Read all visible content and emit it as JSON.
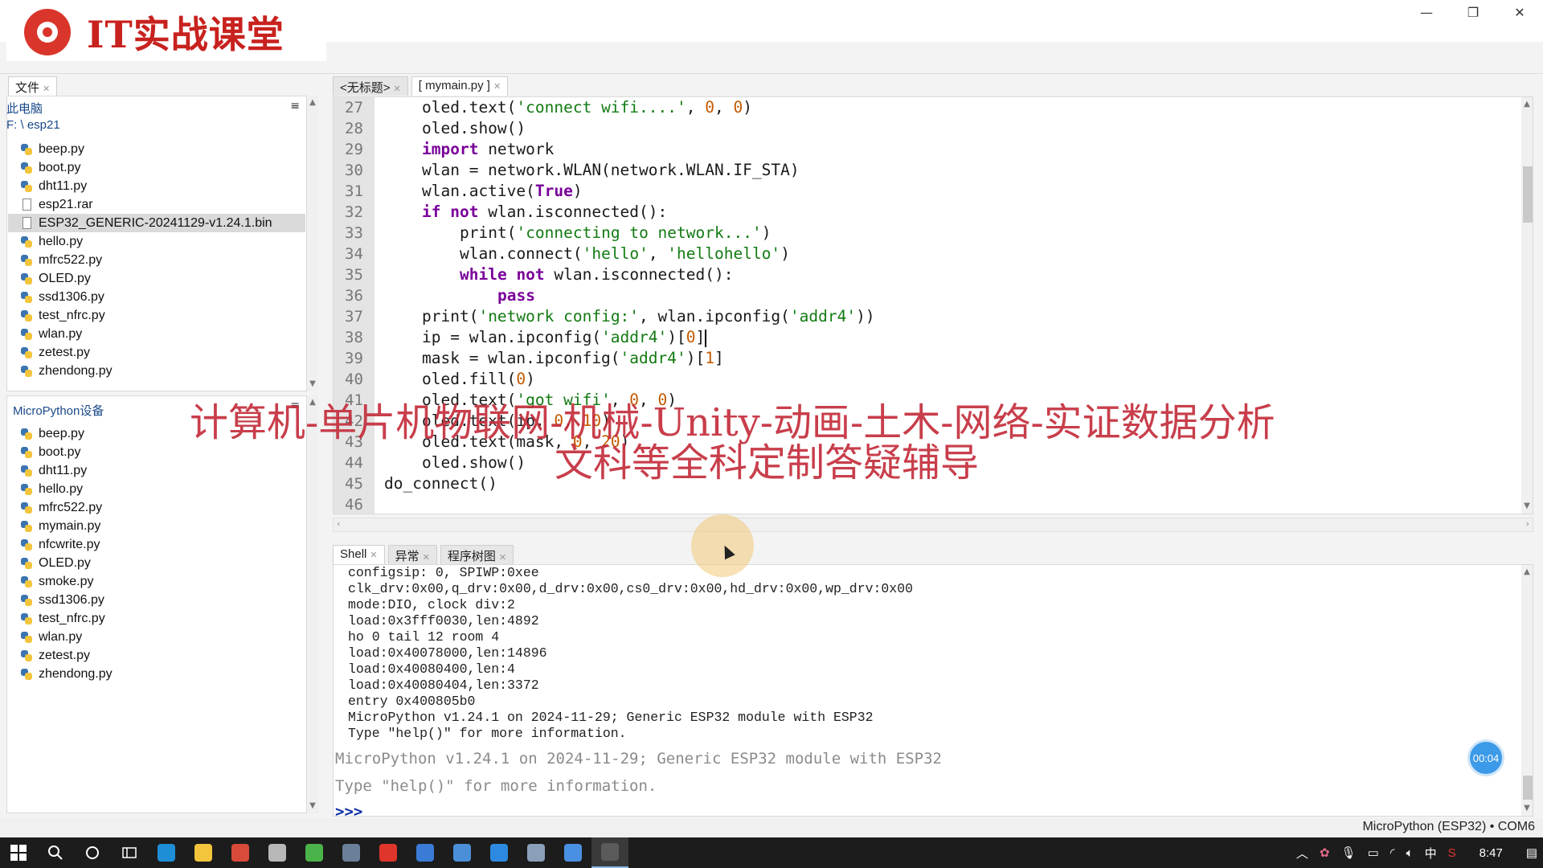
{
  "logo": {
    "text": "IT实战课堂"
  },
  "window_controls": {
    "minimize": "—",
    "restore": "❐",
    "close": "✕"
  },
  "files_panel": {
    "tab_label": "文件",
    "computer_label": "此电脑",
    "path": "F: \\ esp21",
    "files": [
      {
        "name": "beep.py",
        "type": "py"
      },
      {
        "name": "boot.py",
        "type": "py"
      },
      {
        "name": "dht11.py",
        "type": "py"
      },
      {
        "name": "esp21.rar",
        "type": "file"
      },
      {
        "name": "ESP32_GENERIC-20241129-v1.24.1.bin",
        "type": "file",
        "selected": true
      },
      {
        "name": "hello.py",
        "type": "py"
      },
      {
        "name": "mfrc522.py",
        "type": "py"
      },
      {
        "name": "OLED.py",
        "type": "py"
      },
      {
        "name": "ssd1306.py",
        "type": "py"
      },
      {
        "name": "test_nfrc.py",
        "type": "py"
      },
      {
        "name": "wlan.py",
        "type": "py"
      },
      {
        "name": "zetest.py",
        "type": "py"
      },
      {
        "name": "zhendong.py",
        "type": "py"
      }
    ]
  },
  "device_panel": {
    "header": "MicroPython设备",
    "files": [
      {
        "name": "beep.py"
      },
      {
        "name": "boot.py"
      },
      {
        "name": "dht11.py"
      },
      {
        "name": "hello.py"
      },
      {
        "name": "mfrc522.py"
      },
      {
        "name": "mymain.py"
      },
      {
        "name": "nfcwrite.py"
      },
      {
        "name": "OLED.py"
      },
      {
        "name": "smoke.py"
      },
      {
        "name": "ssd1306.py"
      },
      {
        "name": "test_nfrc.py"
      },
      {
        "name": "wlan.py"
      },
      {
        "name": "zetest.py"
      },
      {
        "name": "zhendong.py"
      }
    ]
  },
  "editor": {
    "tabs": [
      {
        "label": "<无标题>"
      },
      {
        "label": "[ mymain.py ]"
      }
    ],
    "lines": [
      {
        "num": "27",
        "indent": 1,
        "tokens": [
          [
            "t",
            "oled.text("
          ],
          [
            "s",
            "'connect wifi....'"
          ],
          [
            "t",
            ", "
          ],
          [
            "n",
            "0"
          ],
          [
            "t",
            ", "
          ],
          [
            "n",
            "0"
          ],
          [
            "t",
            ")"
          ]
        ]
      },
      {
        "num": "28",
        "indent": 1,
        "tokens": [
          [
            "t",
            "oled.show()"
          ]
        ]
      },
      {
        "num": "29",
        "indent": 1,
        "tokens": [
          [
            "k",
            "import"
          ],
          [
            "t",
            " network"
          ]
        ]
      },
      {
        "num": "30",
        "indent": 1,
        "tokens": [
          [
            "t",
            "wlan = network.WLAN(network.WLAN.IF_STA)"
          ]
        ]
      },
      {
        "num": "31",
        "indent": 1,
        "tokens": [
          [
            "t",
            "wlan.active("
          ],
          [
            "k",
            "True"
          ],
          [
            "t",
            ")"
          ]
        ]
      },
      {
        "num": "32",
        "indent": 1,
        "tokens": [
          [
            "k",
            "if not"
          ],
          [
            "t",
            " wlan.isconnected():"
          ]
        ]
      },
      {
        "num": "33",
        "indent": 2,
        "tokens": [
          [
            "t",
            "print("
          ],
          [
            "s",
            "'connecting to network...'"
          ],
          [
            "t",
            ")"
          ]
        ]
      },
      {
        "num": "34",
        "indent": 2,
        "tokens": [
          [
            "t",
            "wlan.connect("
          ],
          [
            "s",
            "'hello'"
          ],
          [
            "t",
            ", "
          ],
          [
            "s",
            "'hellohello'"
          ],
          [
            "t",
            ")"
          ]
        ]
      },
      {
        "num": "35",
        "indent": 2,
        "tokens": [
          [
            "k",
            "while not"
          ],
          [
            "t",
            " wlan.isconnected():"
          ]
        ]
      },
      {
        "num": "36",
        "indent": 3,
        "tokens": [
          [
            "k",
            "pass"
          ]
        ]
      },
      {
        "num": "37",
        "indent": 1,
        "tokens": [
          [
            "t",
            "print("
          ],
          [
            "s",
            "'network config:'"
          ],
          [
            "t",
            ", wlan.ipconfig("
          ],
          [
            "s",
            "'addr4'"
          ],
          [
            "t",
            "))"
          ]
        ]
      },
      {
        "num": "38",
        "indent": 1,
        "tokens": [
          [
            "t",
            "ip = wlan.ipconfig("
          ],
          [
            "s",
            "'addr4'"
          ],
          [
            "t",
            ")["
          ],
          [
            "n",
            "0"
          ],
          [
            "t",
            "]"
          ],
          [
            "c",
            "caret"
          ]
        ]
      },
      {
        "num": "39",
        "indent": 1,
        "tokens": [
          [
            "t",
            "mask = wlan.ipconfig("
          ],
          [
            "s",
            "'addr4'"
          ],
          [
            "t",
            ")["
          ],
          [
            "n",
            "1"
          ],
          [
            "t",
            "]"
          ]
        ]
      },
      {
        "num": "40",
        "indent": 1,
        "tokens": [
          [
            "t",
            "oled.fill("
          ],
          [
            "n",
            "0"
          ],
          [
            "t",
            ")"
          ]
        ]
      },
      {
        "num": "41",
        "indent": 1,
        "tokens": [
          [
            "t",
            "oled.text("
          ],
          [
            "s",
            "'got wifi'"
          ],
          [
            "t",
            ", "
          ],
          [
            "n",
            "0"
          ],
          [
            "t",
            ", "
          ],
          [
            "n",
            "0"
          ],
          [
            "t",
            ")"
          ]
        ]
      },
      {
        "num": "42",
        "indent": 1,
        "tokens": [
          [
            "t",
            "oled.text(ip, "
          ],
          [
            "n",
            "0"
          ],
          [
            "t",
            ", "
          ],
          [
            "n",
            "10"
          ],
          [
            "t",
            ")"
          ]
        ]
      },
      {
        "num": "43",
        "indent": 1,
        "tokens": [
          [
            "t",
            "oled.text(mask, "
          ],
          [
            "n",
            "0"
          ],
          [
            "t",
            ", "
          ],
          [
            "n",
            "20"
          ],
          [
            "t",
            ")"
          ]
        ]
      },
      {
        "num": "44",
        "indent": 1,
        "tokens": [
          [
            "t",
            "oled.show()"
          ]
        ]
      },
      {
        "num": "45",
        "indent": 0,
        "tokens": [
          [
            "t",
            "do_connect()"
          ]
        ]
      },
      {
        "num": "46",
        "indent": 0,
        "tokens": []
      }
    ]
  },
  "shell": {
    "tabs": [
      {
        "label": "Shell"
      },
      {
        "label": "异常"
      },
      {
        "label": "程序树图"
      }
    ],
    "boot_lines": [
      "configsip: 0, SPIWP:0xee",
      "clk_drv:0x00,q_drv:0x00,d_drv:0x00,cs0_drv:0x00,hd_drv:0x00,wp_drv:0x00",
      "mode:DIO, clock div:2",
      "load:0x3fff0030,len:4892",
      "ho 0 tail 12 room 4",
      "load:0x40078000,len:14896",
      "load:0x40080400,len:4",
      "load:0x40080404,len:3372",
      "entry 0x400805b0",
      "MicroPython v1.24.1 on 2024-11-29; Generic ESP32 module with ESP32",
      "Type \"help()\" for more information."
    ],
    "banner_lines": [
      "MicroPython v1.24.1 on 2024-11-29; Generic ESP32 module with ESP32",
      "Type \"help()\" for more information."
    ],
    "prompt": ">>>"
  },
  "status_bar": {
    "interpreter": "MicroPython (ESP32)  •  COM6"
  },
  "overlay": {
    "line1": "计算机-单片机物联网-机械-Unity-动画-土木-网络-实证数据分析",
    "line2": "文科等全科定制答疑辅导"
  },
  "timer": {
    "label": "00:04"
  },
  "taskbar": {
    "tray_ime": "中",
    "tray_time": "8:47",
    "apps": [
      {
        "name": "edge",
        "color": "#1e8fd6"
      },
      {
        "name": "explorer",
        "color": "#f2c53d"
      },
      {
        "name": "app3",
        "color": "#d84a3a"
      },
      {
        "name": "app4",
        "color": "#b8b8b8"
      },
      {
        "name": "app5",
        "color": "#4ab34a"
      },
      {
        "name": "app6",
        "color": "#6b7f99"
      },
      {
        "name": "wps",
        "color": "#e0352b"
      },
      {
        "name": "app8",
        "color": "#3a7bd5"
      },
      {
        "name": "app9",
        "color": "#4a8fd8"
      },
      {
        "name": "app10",
        "color": "#2c8be0"
      },
      {
        "name": "app11",
        "color": "#8aa0b8"
      },
      {
        "name": "app12",
        "color": "#4a90e2"
      },
      {
        "name": "thonny",
        "color": "#5a5a5a"
      }
    ]
  },
  "colors": {
    "keyword": "#7a0099",
    "string": "#127a12",
    "number": "#c35a00",
    "overlay": "#c42e3c"
  }
}
